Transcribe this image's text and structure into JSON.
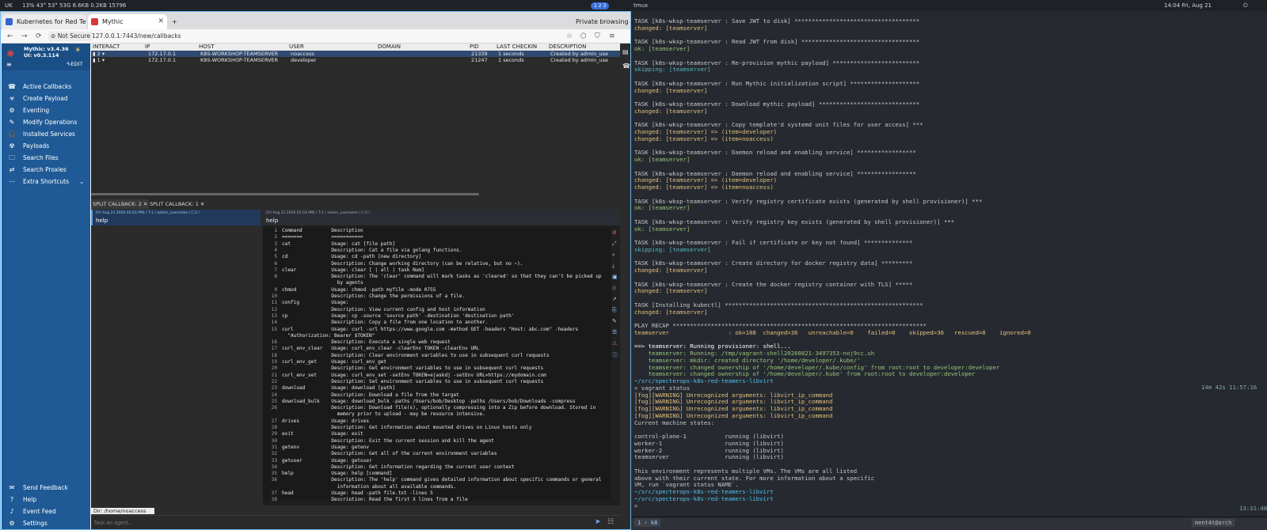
{
  "topbar": {
    "left": "UK",
    "stats": "13%  43°  53°  53G  8.6KB  0.2KB  15796",
    "pill": "1 2 3",
    "title": "tmux",
    "clock": "14:04 Fri, Aug 21"
  },
  "browser": {
    "tabs": [
      {
        "label": "Kubernetes for Red Team",
        "color": "#3465c9"
      },
      {
        "label": "Mythic",
        "color": "#d63838"
      }
    ],
    "private": "Private browsing",
    "url": "127.0.0.1:7443/new/callbacks",
    "not_secure": "Not Secure"
  },
  "sidebar": {
    "brand": "Mythic: v3.4.36",
    "ui": "UI: v0.3.114",
    "edit": "EDIT",
    "items": [
      {
        "label": "Active Callbacks",
        "icon": "☎"
      },
      {
        "label": "Create Payload",
        "icon": "☣"
      },
      {
        "label": "Eventing",
        "icon": "⚙"
      },
      {
        "label": "Modify Operations",
        "icon": "✎"
      },
      {
        "label": "Installed Services",
        "icon": "🎧"
      },
      {
        "label": "Payloads",
        "icon": "☢"
      },
      {
        "label": "Search Files",
        "icon": "🗀"
      },
      {
        "label": "Search Proxies",
        "icon": "⇄"
      },
      {
        "label": "Extra Shortcuts",
        "icon": "⋯"
      }
    ],
    "bottom": [
      {
        "label": "Send Feedback",
        "icon": "✉"
      },
      {
        "label": "Help",
        "icon": "?"
      },
      {
        "label": "Event Feed",
        "icon": "♪"
      },
      {
        "label": "Settings",
        "icon": "⚙"
      }
    ]
  },
  "grid": {
    "headers": [
      "INTERACT",
      "IP",
      "HOST",
      "USER",
      "DOMAIN",
      "PID",
      "LAST CHECKIN",
      "DESCRIPTION"
    ],
    "rows": [
      [
        "▮ 2 ▾",
        "172.17.0.1",
        "K8S-WORKSHOP-TEAMSERVER",
        "noaccess",
        "",
        "21339",
        "1 seconds",
        "Created by admin_use"
      ],
      [
        "▮ 1 ▾",
        "172.17.0.1",
        "K8S-WORKSHOP-TEAMSERVER",
        "developer",
        "",
        "21247",
        "1 seconds",
        "Created by admin_use"
      ]
    ]
  },
  "split": {
    "tab1": "SPLIT CALLBACK: 2",
    "tab2": "SPLIT CALLBACK: 1"
  },
  "task": {
    "meta": "[Fri Aug 21 2026 02:03 PM] / T-1 / admin_username / C-2 /",
    "cmd": "help"
  },
  "help_lines": [
    [
      "1",
      "Command          Description"
    ],
    [
      "2",
      "=======          ==========="
    ],
    [
      "3",
      "cat              Usage: cat [file path]"
    ],
    [
      "4",
      "                 Description: Cat a file via golang functions."
    ],
    [
      "5",
      "cd               Usage: cd -path [new directory]"
    ],
    [
      "6",
      "                 Description: Change working directory (can be relative, but no ~)."
    ],
    [
      "7",
      "clear            Usage: clear [ | all | task Num]"
    ],
    [
      "8",
      "                 Description: The 'clear' command will mark tasks as 'cleared' so that they can't be picked up"
    ],
    [
      "",
      "                   by agents"
    ],
    [
      "9",
      "chmod            Usage: chmod -path myfile -mode 0755"
    ],
    [
      "10",
      "                 Description: Change the permissions of a file."
    ],
    [
      "11",
      "config           Usage:"
    ],
    [
      "12",
      "                 Description: View current config and host information"
    ],
    [
      "13",
      "cp               Usage: cp -source 'source path' -destination 'destination path'"
    ],
    [
      "14",
      "                 Description: Copy a file from one location to another."
    ],
    [
      "15",
      "curl             Usage: curl -url https://www.google.com -method GET -headers \"Host: abc.com\" -headers"
    ],
    [
      "",
      "  \"Authorization: Bearer $TOKEN\""
    ],
    [
      "16",
      "                 Description: Execute a single web request"
    ],
    [
      "17",
      "curl_env_clear   Usage: curl_env_clear -clearEnv TOKEN -clearEnv URL"
    ],
    [
      "18",
      "                 Description: Clear environment variables to use in subsequent curl requests"
    ],
    [
      "19",
      "curl_env_get     Usage: curl_env_get"
    ],
    [
      "20",
      "                 Description: Get environment variables to use in subsequent curl requests"
    ],
    [
      "21",
      "curl_env_set     Usage: curl_env_set -setEnv TOKEN=ejaskdj -setEnv URL=https://mydomain.com"
    ],
    [
      "22",
      "                 Description: Set environment variables to use in subsequent curl requests"
    ],
    [
      "23",
      "download         Usage: download [path]"
    ],
    [
      "24",
      "                 Description: Download a file from the target"
    ],
    [
      "25",
      "download_bulk    Usage: download_bulk -paths /Users/bob/Desktop -paths /Users/bob/Downloads -compress"
    ],
    [
      "26",
      "                 Description: Download file(s), optionally compressing into a Zip before download. Stored in"
    ],
    [
      "",
      "                   memory prior to upload - may be resource intensive."
    ],
    [
      "27",
      "drives           Usage: drives"
    ],
    [
      "28",
      "                 Description: Get information about mounted drives on Linux hosts only"
    ],
    [
      "29",
      "exit             Usage: exit"
    ],
    [
      "30",
      "                 Description: Exit the current session and kill the agent"
    ],
    [
      "31",
      "getenv           Usage: getenv"
    ],
    [
      "32",
      "                 Description: Get all of the current environment variables"
    ],
    [
      "33",
      "getuser          Usage: getuser"
    ],
    [
      "34",
      "                 Description: Get information regarding the current user context"
    ],
    [
      "35",
      "help             Usage: help [command]"
    ],
    [
      "36",
      "                 Description: The 'help' command gives detailed information about specific commands or general"
    ],
    [
      "",
      "                   information about all available commands."
    ],
    [
      "37",
      "head             Usage: head -path file.txt -lines 5"
    ],
    [
      "38",
      "                 Description: Read the first X lines from a file"
    ]
  ],
  "dir": "Dir: /home/noaccess",
  "input_placeholder": "Task an agent...",
  "term_lines": [
    [
      "TASK [k8s-wksp-teamserver : Save JWT to disk] ************************************",
      "#c8c8c8"
    ],
    [
      "changed: [teamserver]",
      "#e5c07b"
    ],
    [
      "",
      ""
    ],
    [
      "TASK [k8s-wksp-teamserver : Read JWT from disk] **********************************",
      "#c8c8c8"
    ],
    [
      "ok: [teamserver]",
      "#98c379"
    ],
    [
      "",
      ""
    ],
    [
      "TASK [k8s-wksp-teamserver : Re-provision mythic payload] *************************",
      "#c8c8c8"
    ],
    [
      "skipping: [teamserver]",
      "#56b6c2"
    ],
    [
      "",
      ""
    ],
    [
      "TASK [k8s-wksp-teamserver : Run Mythic initialization script] ********************",
      "#c8c8c8"
    ],
    [
      "changed: [teamserver]",
      "#e5c07b"
    ],
    [
      "",
      ""
    ],
    [
      "TASK [k8s-wksp-teamserver : Download mythic payload] *****************************",
      "#c8c8c8"
    ],
    [
      "changed: [teamserver]",
      "#e5c07b"
    ],
    [
      "",
      ""
    ],
    [
      "TASK [k8s-wksp-teamserver : Copy template'd systemd unit files for user access] ***",
      "#c8c8c8"
    ],
    [
      "changed: [teamserver] => (item=developer)",
      "#e5c07b"
    ],
    [
      "changed: [teamserver] => (item=noaccess)",
      "#e5c07b"
    ],
    [
      "",
      ""
    ],
    [
      "TASK [k8s-wksp-teamserver : Daemon reload and enabling service] *****************",
      "#c8c8c8"
    ],
    [
      "ok: [teamserver]",
      "#98c379"
    ],
    [
      "",
      ""
    ],
    [
      "TASK [k8s-wksp-teamserver : Daemon reload and enabling service] *****************",
      "#c8c8c8"
    ],
    [
      "changed: [teamserver] => (item=developer)",
      "#e5c07b"
    ],
    [
      "changed: [teamserver] => (item=noaccess)",
      "#e5c07b"
    ],
    [
      "",
      ""
    ],
    [
      "TASK [k8s-wksp-teamserver : Verify registry certificate exists (generated by shell provisioner)] ***",
      "#c8c8c8"
    ],
    [
      "ok: [teamserver]",
      "#98c379"
    ],
    [
      "",
      ""
    ],
    [
      "TASK [k8s-wksp-teamserver : Verify registry key exists (generated by shell provisioner)] ***",
      "#c8c8c8"
    ],
    [
      "ok: [teamserver]",
      "#98c379"
    ],
    [
      "",
      ""
    ],
    [
      "TASK [k8s-wksp-teamserver : Fail if certificate or key not found] **************",
      "#c8c8c8"
    ],
    [
      "skipping: [teamserver]",
      "#56b6c2"
    ],
    [
      "",
      ""
    ],
    [
      "TASK [k8s-wksp-teamserver : Create directory for docker registry data] *********",
      "#c8c8c8"
    ],
    [
      "changed: [teamserver]",
      "#e5c07b"
    ],
    [
      "",
      ""
    ],
    [
      "TASK [k8s-wksp-teamserver : Create the docker registry container with TLS] *****",
      "#c8c8c8"
    ],
    [
      "changed: [teamserver]",
      "#e5c07b"
    ],
    [
      "",
      ""
    ],
    [
      "TASK [Installing kubectl] *********************************************************",
      "#c8c8c8"
    ],
    [
      "changed: [teamserver]",
      "#e5c07b"
    ],
    [
      "",
      ""
    ],
    [
      "PLAY RECAP *************************************************************************",
      "#c8c8c8"
    ],
    [
      "teamserver                 : ok=108  changed=36   unreachable=0    failed=0    skipped=36   rescued=0    ignored=0",
      "#e5c07b"
    ],
    [
      "",
      ""
    ],
    [
      "==> teamserver: Running provisioner: shell...",
      "#ffffff"
    ],
    [
      "    teamserver: Running: /tmp/vagrant-shell20260821-3497353-noj9cc.sh",
      "#98c379"
    ],
    [
      "    teamserver: mkdir: created directory '/home/developer/.kube/'",
      "#98c379"
    ],
    [
      "    teamserver: changed ownership of '/home/developer/.kube/config' from root:root to developer:developer",
      "#98c379"
    ],
    [
      "    teamserver: changed ownership of '/home/developer/.kube' from root:root to developer:developer",
      "#98c379"
    ],
    [
      "~/src/specterops-k8s-red-teamers-libvirt",
      "#4fc3f7"
    ],
    [
      "> vagrant status",
      "#c8c8c8"
    ],
    [
      "[fog][WARNING] Unrecognized arguments: libvirt_ip_command",
      "#e5c07b"
    ],
    [
      "[fog][WARNING] Unrecognized arguments: libvirt_ip_command",
      "#e5c07b"
    ],
    [
      "[fog][WARNING] Unrecognized arguments: libvirt_ip_command",
      "#e5c07b"
    ],
    [
      "[fog][WARNING] Unrecognized arguments: libvirt_ip_command",
      "#e5c07b"
    ],
    [
      "Current machine states:",
      "#c8c8c8"
    ],
    [
      "",
      ""
    ],
    [
      "control-plane-1           running (libvirt)",
      "#c8c8c8"
    ],
    [
      "worker-1                  running (libvirt)",
      "#c8c8c8"
    ],
    [
      "worker-2                  running (libvirt)",
      "#c8c8c8"
    ],
    [
      "teamserver                running (libvirt)",
      "#c8c8c8"
    ],
    [
      "",
      ""
    ],
    [
      "This environment represents multiple VMs. The VMs are all listed",
      "#c8c8c8"
    ],
    [
      "above with their current state. For more information about a specific",
      "#c8c8c8"
    ],
    [
      "VM, run `vagrant status NAME`.",
      "#c8c8c8"
    ],
    [
      "~/src/specterops-k8s-red-teamers-libvirt",
      "#4fc3f7"
    ],
    [
      "~/src/specterops-k8s-red-teamers-libvirt",
      "#4fc3f7"
    ],
    [
      ">",
      "#c8c8c8"
    ]
  ],
  "term_right": {
    "t1": "14m 42s 11:57:16",
    "t2": "13:31:48"
  },
  "tmux": {
    "left": "1 › k8",
    "right": "ment4t@arch"
  }
}
